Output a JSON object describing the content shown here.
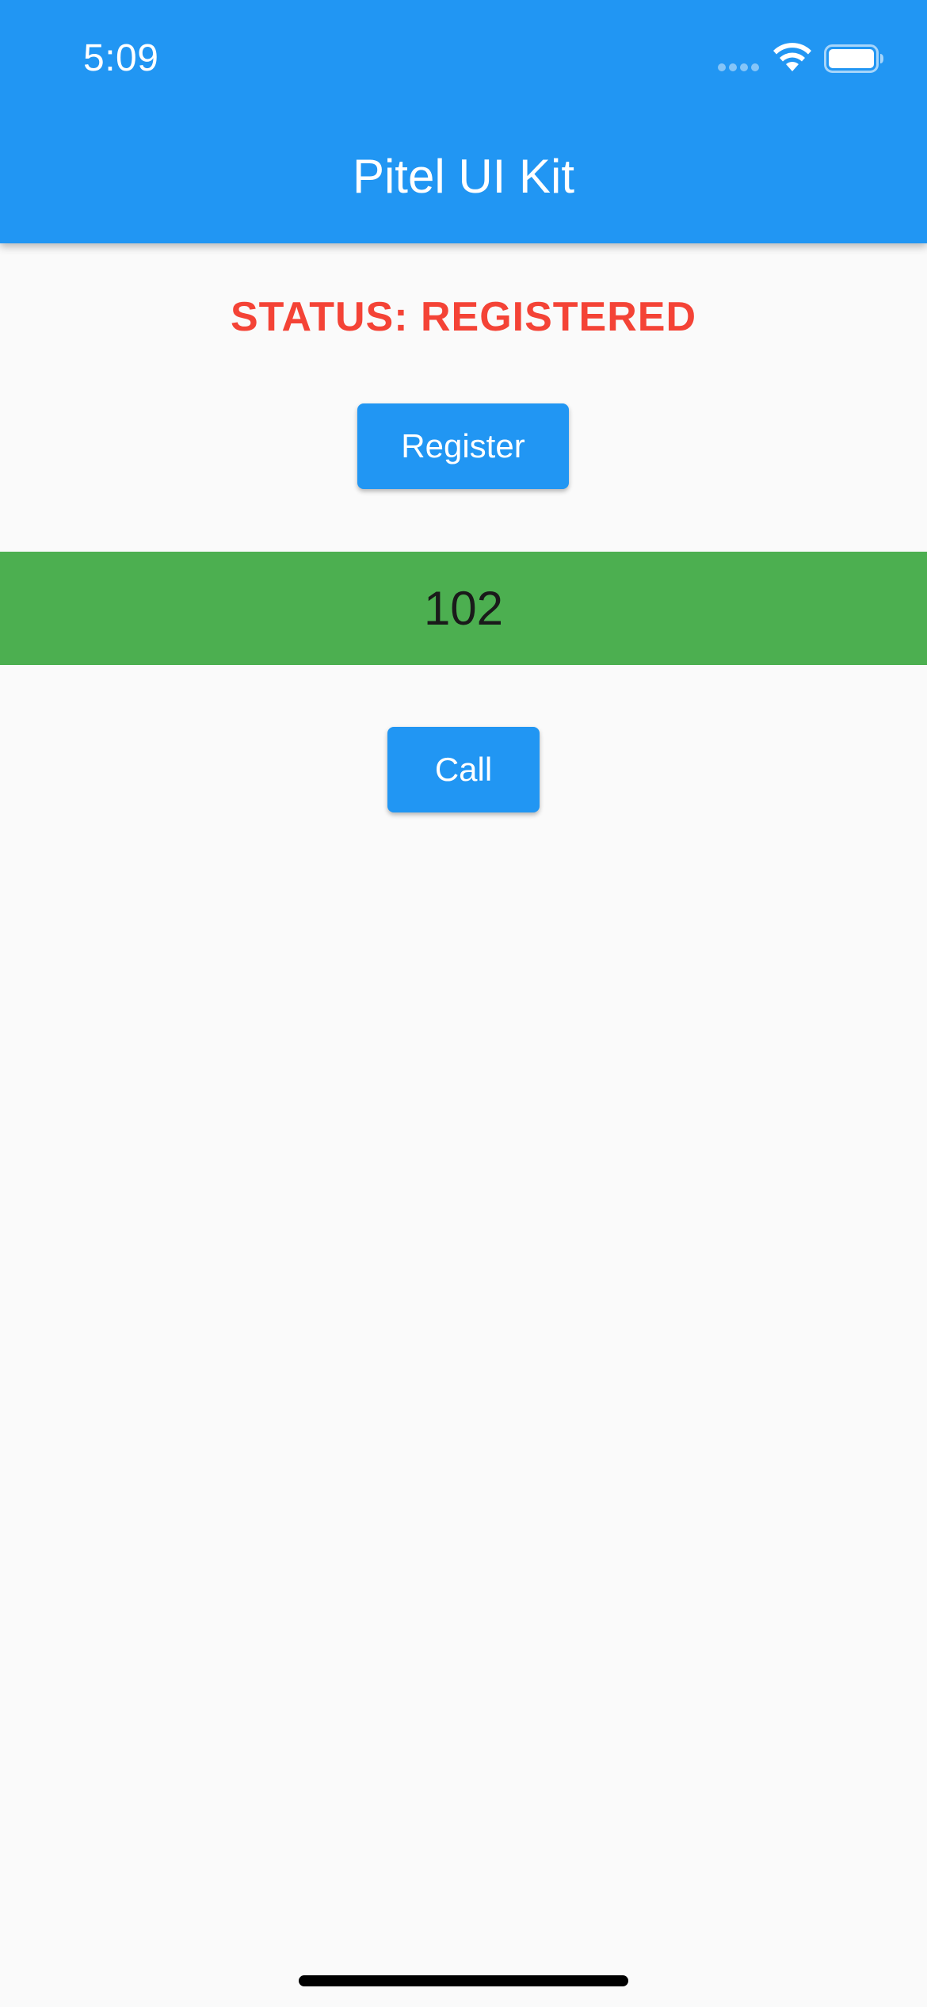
{
  "status_bar": {
    "time": "5:09",
    "icons": [
      "signal-icon",
      "wifi-icon",
      "battery-icon"
    ]
  },
  "app_bar": {
    "title": "Pitel UI Kit"
  },
  "main": {
    "status_text": "STATUS: REGISTERED",
    "register_label": "Register",
    "phone_number": "102",
    "call_label": "Call"
  },
  "colors": {
    "primary": "#2196f3",
    "status": "#f44336",
    "input_background": "#4caf50",
    "background": "#fafafa"
  }
}
